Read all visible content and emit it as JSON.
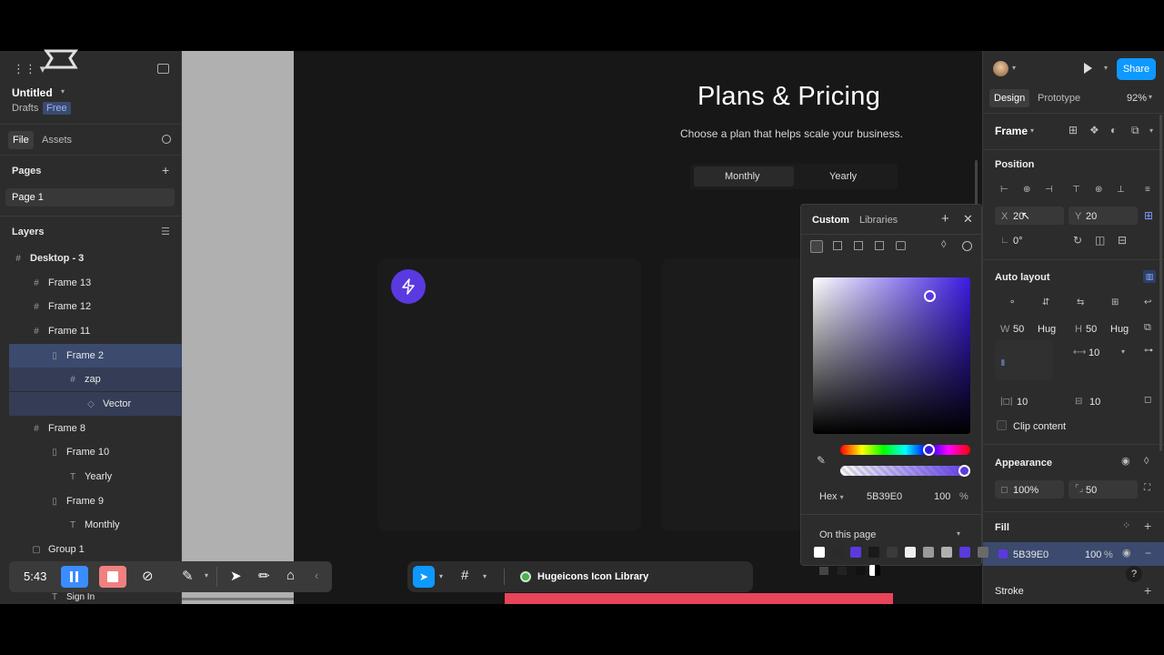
{
  "file": {
    "title": "Untitled",
    "location": "Drafts",
    "plan_badge": "Free"
  },
  "left_tabs": {
    "file": "File",
    "assets": "Assets"
  },
  "pages": {
    "header": "Pages",
    "items": [
      "Page 1"
    ]
  },
  "layers": {
    "header": "Layers",
    "items": [
      {
        "label": "Desktop - 3"
      },
      {
        "label": "Frame 13"
      },
      {
        "label": "Frame 12"
      },
      {
        "label": "Frame 11"
      },
      {
        "label": "Frame 2"
      },
      {
        "label": "zap"
      },
      {
        "label": "Vector"
      },
      {
        "label": "Frame 8"
      },
      {
        "label": "Frame 10"
      },
      {
        "label": "Yearly"
      },
      {
        "label": "Frame 9"
      },
      {
        "label": "Monthly"
      },
      {
        "label": "Group 1"
      },
      {
        "label": "Sign In"
      }
    ]
  },
  "canvas": {
    "heading": "Plans & Pricing",
    "subheading": "Choose a plan that helps scale your business.",
    "toggle": {
      "monthly": "Monthly",
      "yearly": "Yearly"
    }
  },
  "right_panel": {
    "share": "Share",
    "tabs": {
      "design": "Design",
      "prototype": "Prototype"
    },
    "zoom": "92%",
    "frame_label": "Frame",
    "position": {
      "header": "Position",
      "x_label": "X",
      "x": "20",
      "y_label": "Y",
      "y": "20",
      "rotation": "0°"
    },
    "auto_layout": {
      "header": "Auto layout",
      "w_label": "W",
      "w": "50",
      "w_mode": "Hug",
      "h_label": "H",
      "h": "50",
      "h_mode": "Hug",
      "gap": "10",
      "pad_h": "10",
      "pad_v": "10",
      "clip": "Clip content"
    },
    "appearance": {
      "header": "Appearance",
      "opacity": "100%",
      "radius": "50"
    },
    "fill": {
      "header": "Fill",
      "hex": "5B39E0",
      "opacity": "100",
      "unit": "%"
    },
    "stroke": {
      "header": "Stroke"
    }
  },
  "picker": {
    "tabs": {
      "custom": "Custom",
      "libraries": "Libraries"
    },
    "mode": "Hex",
    "hex": "5B39E0",
    "opacity": "100",
    "unit": "%",
    "swatches_header": "On this page",
    "swatch_colors": [
      "#ffffff",
      "#2a2a2a",
      "#5b39e0",
      "#1a1a1a",
      "#3a3a3a",
      "#f0f0f0",
      "#9a9a9a",
      "#b0b0b0",
      "#5b39e0",
      "#6a6a6a"
    ]
  },
  "recorder": {
    "time": "5:43"
  },
  "toolbar": {
    "plugin": "Hugeicons Icon Library"
  },
  "accent": "#5b39e0",
  "share_color": "#0d99ff"
}
